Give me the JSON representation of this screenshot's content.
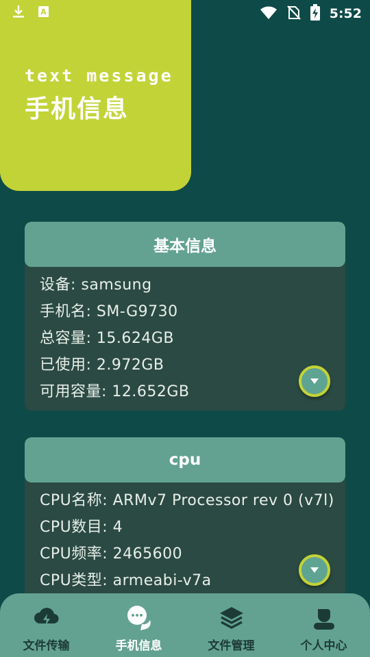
{
  "status_bar": {
    "time": "5:52",
    "icons_left": [
      "download-icon",
      "a-notification-icon"
    ],
    "icons_right": [
      "wifi-icon",
      "no-sim-icon",
      "battery-charging-icon"
    ]
  },
  "header": {
    "subtitle": "text message",
    "title": "手机信息"
  },
  "basic_info": {
    "title": "基本信息",
    "rows": [
      "设备: samsung",
      "手机名: SM-G9730",
      "总容量: 15.624GB",
      "已使用: 2.972GB",
      "可用容量: 12.652GB"
    ]
  },
  "cpu_info": {
    "title": "cpu",
    "rows": [
      "CPU名称: ARMv7 Processor rev 0 (v7l)",
      "CPU数目: 4",
      "CPU频率: 2465600",
      "CPU类型: armeabi-v7a"
    ]
  },
  "bottom_nav": {
    "items": [
      {
        "label": "文件传输",
        "icon": "cloud-transfer-icon",
        "active": false
      },
      {
        "label": "手机信息",
        "icon": "chat-bubbles-icon",
        "active": true
      },
      {
        "label": "文件管理",
        "icon": "layers-icon",
        "active": false
      },
      {
        "label": "个人中心",
        "icon": "user-icon",
        "active": false
      }
    ]
  },
  "colors": {
    "background": "#0e4a48",
    "accent": "#c2d337",
    "card_header": "#63a291",
    "card_body": "#2b4a43"
  }
}
